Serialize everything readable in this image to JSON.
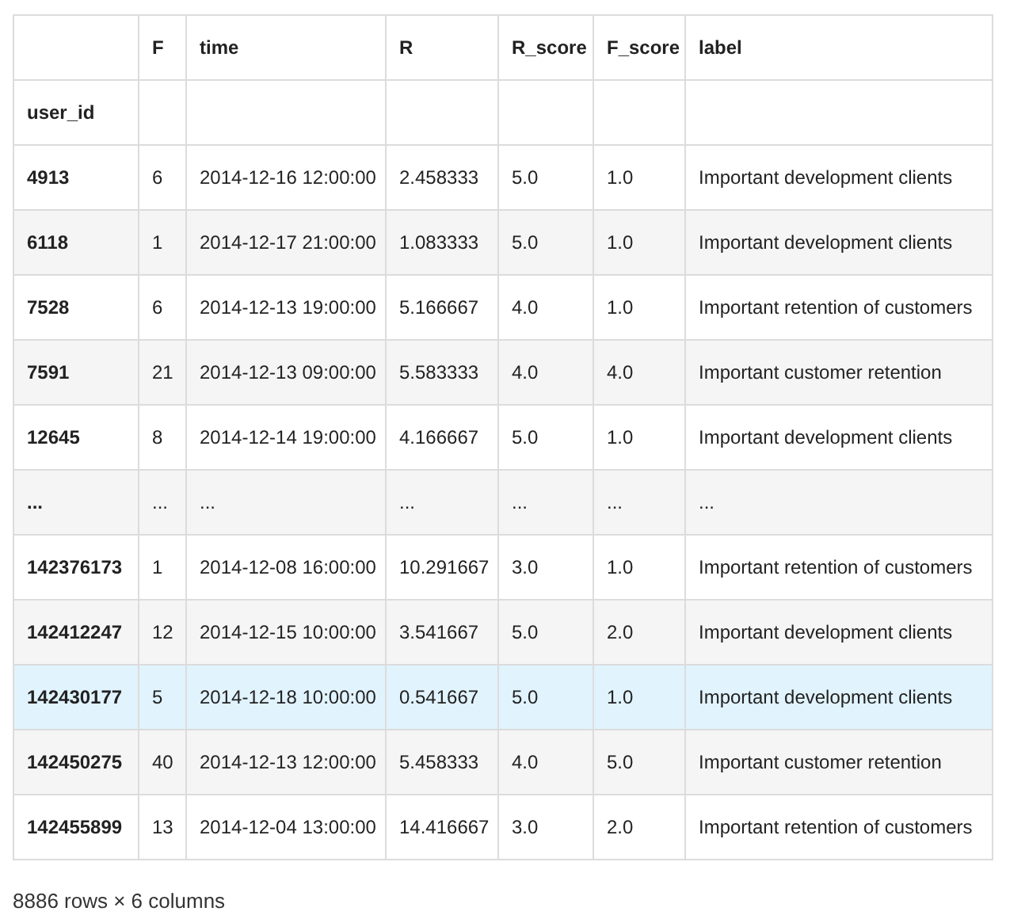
{
  "table": {
    "columns": [
      "F",
      "time",
      "R",
      "R_score",
      "F_score",
      "label"
    ],
    "index_name": "user_id",
    "rows": [
      {
        "index": "4913",
        "cells": [
          "6",
          "2014-12-16 12:00:00",
          "2.458333",
          "5.0",
          "1.0",
          "Important development clients"
        ],
        "highlighted": false
      },
      {
        "index": "6118",
        "cells": [
          "1",
          "2014-12-17 21:00:00",
          "1.083333",
          "5.0",
          "1.0",
          "Important development clients"
        ],
        "highlighted": false
      },
      {
        "index": "7528",
        "cells": [
          "6",
          "2014-12-13 19:00:00",
          "5.166667",
          "4.0",
          "1.0",
          "Important retention of customers"
        ],
        "highlighted": false
      },
      {
        "index": "7591",
        "cells": [
          "21",
          "2014-12-13 09:00:00",
          "5.583333",
          "4.0",
          "4.0",
          "Important customer retention"
        ],
        "highlighted": false
      },
      {
        "index": "12645",
        "cells": [
          "8",
          "2014-12-14 19:00:00",
          "4.166667",
          "5.0",
          "1.0",
          "Important development clients"
        ],
        "highlighted": false
      },
      {
        "index": "...",
        "cells": [
          "...",
          "...",
          "...",
          "...",
          "...",
          "..."
        ],
        "highlighted": false
      },
      {
        "index": "142376173",
        "cells": [
          "1",
          "2014-12-08 16:00:00",
          "10.291667",
          "3.0",
          "1.0",
          "Important retention of customers"
        ],
        "highlighted": false
      },
      {
        "index": "142412247",
        "cells": [
          "12",
          "2014-12-15 10:00:00",
          "3.541667",
          "5.0",
          "2.0",
          "Important development clients"
        ],
        "highlighted": false
      },
      {
        "index": "142430177",
        "cells": [
          "5",
          "2014-12-18 10:00:00",
          "0.541667",
          "5.0",
          "1.0",
          "Important development clients"
        ],
        "highlighted": true
      },
      {
        "index": "142450275",
        "cells": [
          "40",
          "2014-12-13 12:00:00",
          "5.458333",
          "4.0",
          "5.0",
          "Important customer retention"
        ],
        "highlighted": false
      },
      {
        "index": "142455899",
        "cells": [
          "13",
          "2014-12-04 13:00:00",
          "14.416667",
          "3.0",
          "2.0",
          "Important retention of customers"
        ],
        "highlighted": false
      }
    ]
  },
  "footer": "8886 rows × 6 columns"
}
